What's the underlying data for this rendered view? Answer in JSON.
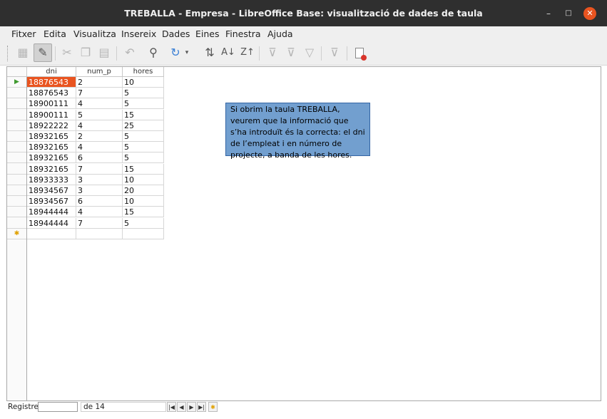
{
  "window": {
    "title": "TREBALLA - Empresa - LibreOffice Base: visualització de dades de taula",
    "minimize": "–",
    "maximize": "□",
    "close": "✕"
  },
  "menu": [
    "Fitxer",
    "Edita",
    "Visualitza",
    "Insereix",
    "Dades",
    "Eines",
    "Finestra",
    "Ajuda"
  ],
  "toolbar": {
    "icons": [
      "save-record-icon",
      "edit-data-icon",
      "cut-icon",
      "copy-icon",
      "paste-icon",
      "undo-icon",
      "find-icon",
      "refresh-icon",
      "sort-icon",
      "sort-ascending-icon",
      "sort-descending-icon",
      "autofilter-icon",
      "standard-filter-icon",
      "apply-filter-icon",
      "reset-filter-icon",
      "delete-record-icon"
    ]
  },
  "table": {
    "columns": [
      "dni",
      "num_p",
      "hores"
    ],
    "rows": [
      [
        "18876543",
        "2",
        "10"
      ],
      [
        "18876543",
        "7",
        "5"
      ],
      [
        "18900111",
        "4",
        "5"
      ],
      [
        "18900111",
        "5",
        "15"
      ],
      [
        "18922222",
        "4",
        "25"
      ],
      [
        "18932165",
        "2",
        "5"
      ],
      [
        "18932165",
        "4",
        "5"
      ],
      [
        "18932165",
        "6",
        "5"
      ],
      [
        "18932165",
        "7",
        "15"
      ],
      [
        "18933333",
        "3",
        "10"
      ],
      [
        "18934567",
        "3",
        "20"
      ],
      [
        "18934567",
        "6",
        "10"
      ],
      [
        "18944444",
        "4",
        "15"
      ],
      [
        "18944444",
        "7",
        "5"
      ]
    ],
    "current_marker": "▶",
    "new_row_marker": "✱"
  },
  "note": "Si obrim la taula TREBALLA, veurem que la informació que s’ha introduït és la correcta: el dni de l’empleat i en número de projecte, a banda de les hores.",
  "status": {
    "label": "Registre",
    "record_value": "",
    "of_text": "de 14",
    "nav": [
      "|◀",
      "◀",
      "▶",
      "▶|",
      "✱"
    ]
  },
  "colors": {
    "accent": "#e95420",
    "note_bg": "#729fcf",
    "titlebar": "#2f2f2f"
  }
}
